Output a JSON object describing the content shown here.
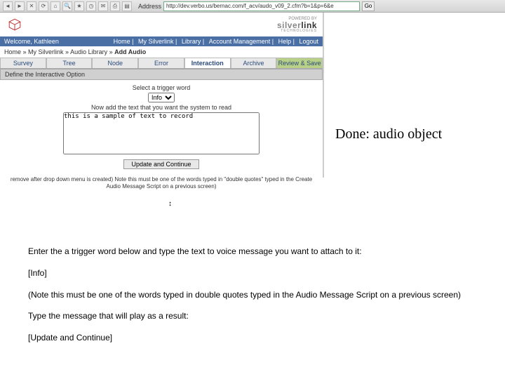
{
  "browser": {
    "address_label": "Address",
    "url": "http://dev.verbo.us/bernac.com/f_acv/audo_v09_2.cfm?b=1&p=6&e",
    "go": "Go"
  },
  "brand": {
    "powered": "POWERED BY",
    "name1": "silver",
    "name2": "link",
    "sub": "TECHNOLOGIES"
  },
  "welcome": {
    "text": "Welcome, Kathleen",
    "links": [
      "Home",
      "My Silverlink",
      "Library",
      "Account Management",
      "Help",
      "Logout"
    ]
  },
  "breadcrumb": {
    "home": "Home",
    "mid": "My Silverlink",
    "lib": "Audio Library",
    "current": "Add Audio"
  },
  "tabs": [
    "Survey",
    "Tree",
    "Node",
    "Error",
    "Interaction",
    "Archive",
    "Review & Save"
  ],
  "section_header": "Define the Interactive Option",
  "form": {
    "select_label": "Select a trigger word",
    "select_value": "Info",
    "type_label": "Now add the text that you want the system to read",
    "textarea_value": "this is a sample of text to record",
    "button": "Update and Continue"
  },
  "remove_note": "remove after drop down menu is created) Note this must be one of the words typed in \"double quotes\" typed in the Create Audio Message Script on a previous screen)",
  "annotation": "Done: audio object",
  "instructions": {
    "l1": "Enter the a trigger word below and type the text to voice message you want to attach to it:",
    "l2": "[Info]",
    "l3": "(Note this must be one of the words typed in double quotes typed in the Audio Message Script on a previous screen)",
    "l4": "Type the message that will play as a result:",
    "l5": "[Update and Continue]"
  }
}
